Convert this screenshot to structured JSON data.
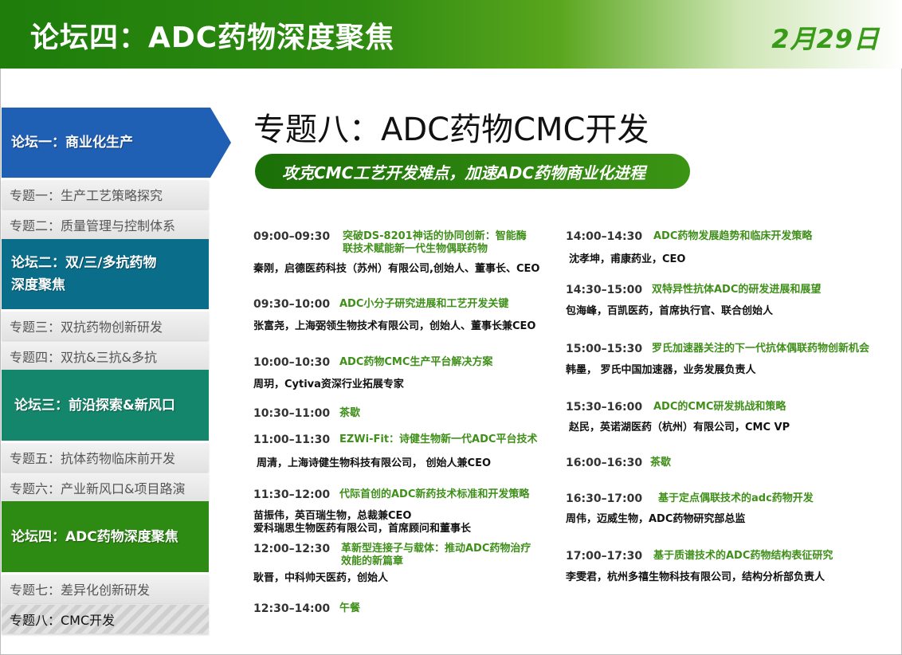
{
  "header": {
    "title": "论坛四：ADC药物深度聚焦",
    "date": "2月29日"
  },
  "sidebar": {
    "forum1": "论坛一：商业化生产",
    "topic1": "专题一：生产工艺策略探究",
    "topic2": "专题二：质量管理与控制体系",
    "forum2_l1": "论坛二：双/三/多抗药物",
    "forum2_l2": "深度聚焦",
    "topic3": "专题三：双抗药物创新研发",
    "topic4": "专题四：双抗&三抗&多抗",
    "forum3": "论坛三：前沿探索&新风口",
    "topic5": "专题五：抗体药物临床前开发",
    "topic6": "专题六：产业新风口&项目路演",
    "forum4": "论坛四：ADC药物深度聚焦",
    "topic7": "专题七：差异化创新研发",
    "topic8": "专题八：CMC开发"
  },
  "main": {
    "title": "专题八：ADC药物CMC开发",
    "subtitle": "攻克CMC工艺开发难点，加速ADC药物商业化进程"
  },
  "colors": {
    "forum1": "#1f5fb4",
    "forum2": "#0a6e8b",
    "forum3": "#13866b",
    "forum4": "#2d8a12",
    "accent": "#3f8f1a"
  },
  "left": [
    {
      "time": "09:00–09:30",
      "talk1": "突破DS-8201神话的协同创新：智能酶",
      "talk2": "联技术赋能新一代生物偶联药物",
      "spk1": "秦刚，启德医药科技（苏州）有限公司,创始人、董事长、CEO",
      "spk2": ""
    },
    {
      "time": "09:30–10:00",
      "talk1": "ADC小分子研究进展和工艺开发关键",
      "talk2": "",
      "spk1": "张富尧，上海弼领生物技术有限公司，创始人、董事长兼CEO",
      "spk2": ""
    },
    {
      "time": "10:00–10:30",
      "talk1": "ADC药物CMC生产平台解决方案",
      "talk2": "",
      "spk1": "周玥，Cytiva资深行业拓展专家",
      "spk2": ""
    },
    {
      "time": "10:30–11:00",
      "talk1": "茶歇",
      "talk2": "",
      "spk1": "",
      "spk2": ""
    },
    {
      "time": "11:00–11:30",
      "talk1": "EZWi-Fit：诗健生物新一代ADC平台技术",
      "talk2": "",
      "spk1": "周清，上海诗健生物科技有限公司， 创始人兼CEO",
      "spk2": ""
    },
    {
      "time": "11:30–12:00",
      "talk1": "代际首创的ADC新药技术标准和开发策略",
      "talk2": "",
      "spk1": "苗振伟，英百瑞生物，总裁兼CEO",
      "spk2": "爱科瑞思生物医药有限公司，首席顾问和董事长"
    },
    {
      "time": "12:00–12:30",
      "talk1": "革新型连接子与载体：推动ADC药物治疗",
      "talk2": "效能的新篇章",
      "spk1": "耿晋，中科帅天医药，创始人",
      "spk2": ""
    },
    {
      "time": "12:30–14:00",
      "talk1": "午餐",
      "talk2": "",
      "spk1": "",
      "spk2": ""
    }
  ],
  "right": [
    {
      "time": "14:00–14:30",
      "talk1": "ADC药物发展趋势和临床开发策略",
      "spk1": "沈孝坤，甫康药业，CEO"
    },
    {
      "time": "14:30–15:00",
      "talk1": "双特异性抗体ADC的研发进展和展望",
      "spk1": "包海峰，百凯医药，首席执行官、联合创始人"
    },
    {
      "time": "15:00–15:30",
      "talk1": "罗氏加速器关注的下一代抗体偶联药物创新机会",
      "spk1": "韩墨， 罗氏中国加速器，业务发展负责人"
    },
    {
      "time": "15:30–16:00",
      "talk1": "ADC的CMC研发挑战和策略",
      "spk1": "赵民，英诺湖医药（杭州）有限公司，CMC VP"
    },
    {
      "time": "16:00–16:30",
      "talk1": "茶歇",
      "spk1": ""
    },
    {
      "time": "16:30–17:00",
      "talk1": "基于定点偶联技术的adc药物开发",
      "spk1": "周伟，迈威生物，ADC药物研究部总监"
    },
    {
      "time": "17:00–17:30",
      "talk1": "基于质谱技术的ADC药物结构表征研究",
      "spk1": "李雯君，杭州多禧生物科技有限公司，结构分析部负责人"
    }
  ]
}
